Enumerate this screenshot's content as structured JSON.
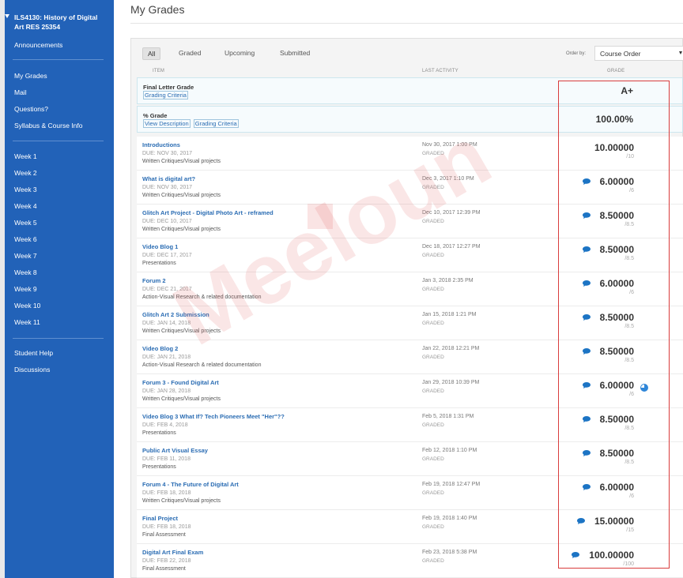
{
  "sidebar": {
    "course_title": "ILS4130: History of Digital Art RES 25354",
    "announcements": "Announcements",
    "group1": [
      "My Grades",
      "Mail",
      "Questions?",
      "Syllabus & Course Info"
    ],
    "weeks": [
      "Week 1",
      "Week 2",
      "Week 3",
      "Week 4",
      "Week 5",
      "Week 6",
      "Week 7",
      "Week 8",
      "Week 9",
      "Week 10",
      "Week 11"
    ],
    "group3": [
      "Student Help",
      "Discussions"
    ]
  },
  "main": {
    "title": "My Grades",
    "filters": [
      "All",
      "Graded",
      "Upcoming",
      "Submitted"
    ],
    "active_filter": "All",
    "order_by_label": "Order by:",
    "order_by_value": "Course Order",
    "columns": {
      "item": "ITEM",
      "last_activity": "LAST ACTIVITY",
      "grade": "GRADE"
    }
  },
  "summary_rows": [
    {
      "title": "Final Letter Grade",
      "links": [
        "Grading Criteria"
      ],
      "grade": "A+"
    },
    {
      "title": "% Grade",
      "links": [
        "View Description",
        "Grading Criteria"
      ],
      "grade": "100.00%"
    }
  ],
  "grade_rows": [
    {
      "title": "Introductions",
      "due": "DUE: NOV 30, 2017",
      "category": "Written Critiques/Visual projects",
      "activity": "Nov 30, 2017 1:00 PM",
      "status": "GRADED",
      "grade": "10.00000",
      "out_of": "/10",
      "comment": false,
      "pie": false
    },
    {
      "title": "What is digital art?",
      "due": "DUE: NOV 30, 2017",
      "category": "Written Critiques/Visual projects",
      "activity": "Dec 3, 2017 1:10 PM",
      "status": "GRADED",
      "grade": "6.00000",
      "out_of": "/6",
      "comment": true,
      "pie": false
    },
    {
      "title": "Glitch Art Project - Digital Photo Art - reframed",
      "due": "DUE: DEC 10, 2017",
      "category": "Written Critiques/Visual projects",
      "activity": "Dec 10, 2017 12:39 PM",
      "status": "GRADED",
      "grade": "8.50000",
      "out_of": "/8.5",
      "comment": true,
      "pie": false
    },
    {
      "title": "Video Blog 1",
      "due": "DUE: DEC 17, 2017",
      "category": "Presentations",
      "activity": "Dec 18, 2017 12:27 PM",
      "status": "GRADED",
      "grade": "8.50000",
      "out_of": "/8.5",
      "comment": true,
      "pie": false
    },
    {
      "title": "Forum 2",
      "due": "DUE: DEC 21, 2017",
      "category": "Action-Visual Research & related documentation",
      "activity": "Jan 3, 2018 2:35 PM",
      "status": "GRADED",
      "grade": "6.00000",
      "out_of": "/6",
      "comment": true,
      "pie": false
    },
    {
      "title": "Glitch Art 2 Submission",
      "due": "DUE: JAN 14, 2018",
      "category": "Written Critiques/Visual projects",
      "activity": "Jan 15, 2018 1:21 PM",
      "status": "GRADED",
      "grade": "8.50000",
      "out_of": "/8.5",
      "comment": true,
      "pie": false
    },
    {
      "title": "Video Blog 2",
      "due": "DUE: JAN 21, 2018",
      "category": "Action-Visual Research & related documentation",
      "activity": "Jan 22, 2018 12:21 PM",
      "status": "GRADED",
      "grade": "8.50000",
      "out_of": "/8.5",
      "comment": true,
      "pie": false
    },
    {
      "title": "Forum 3 - Found Digital Art",
      "due": "DUE: JAN 28, 2018",
      "category": "Written Critiques/Visual projects",
      "activity": "Jan 29, 2018 10:39 PM",
      "status": "GRADED",
      "grade": "6.00000",
      "out_of": "/6",
      "comment": true,
      "pie": true
    },
    {
      "title": "Video Blog 3 What If? Tech Pioneers Meet \"Her\"??",
      "due": "DUE: FEB 4, 2018",
      "category": "Presentations",
      "activity": "Feb 5, 2018 1:31 PM",
      "status": "GRADED",
      "grade": "8.50000",
      "out_of": "/8.5",
      "comment": true,
      "pie": false
    },
    {
      "title": "Public Art Visual Essay",
      "due": "DUE: FEB 11, 2018",
      "category": "Presentations",
      "activity": "Feb 12, 2018 1:10 PM",
      "status": "GRADED",
      "grade": "8.50000",
      "out_of": "/8.5",
      "comment": true,
      "pie": false
    },
    {
      "title": "Forum 4 - The Future of Digital Art",
      "due": "DUE: FEB 18, 2018",
      "category": "Written Critiques/Visual projects",
      "activity": "Feb 19, 2018 12:47 PM",
      "status": "GRADED",
      "grade": "6.00000",
      "out_of": "/6",
      "comment": true,
      "pie": false
    },
    {
      "title": "Final Project",
      "due": "DUE: FEB 18, 2018",
      "category": "Final Assessment",
      "activity": "Feb 19, 2018 1:40 PM",
      "status": "GRADED",
      "grade": "15.00000",
      "out_of": "/15",
      "comment": true,
      "pie": false
    },
    {
      "title": "Digital Art Final Exam",
      "due": "DUE: FEB 22, 2018",
      "category": "Final Assessment",
      "activity": "Feb 23, 2018 5:38 PM",
      "status": "GRADED",
      "grade": "100.00000",
      "out_of": "/100",
      "comment": true,
      "pie": false
    }
  ],
  "watermark": "Meeloun",
  "colors": {
    "sidebar": "#2262b8",
    "link": "#2a6cb3",
    "highlight_box": "#d93c3c",
    "comment_icon": "#1c74c4"
  }
}
